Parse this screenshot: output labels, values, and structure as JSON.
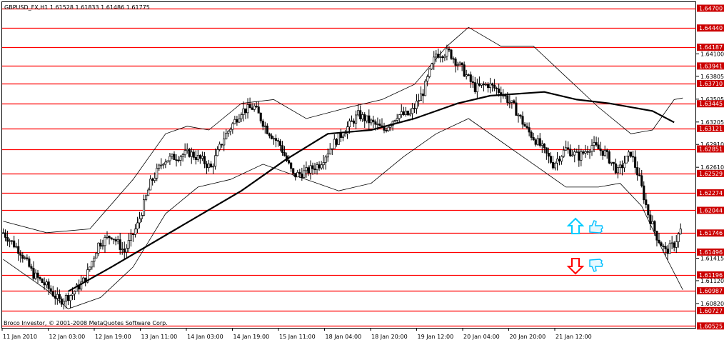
{
  "header": {
    "symbol_line": "GBPUSD_FX,H1  1.61528 1.61833 1.61486 1.61775"
  },
  "credit": "Broco Investor, © 2001-2008 MetaQuotes Software Corp.",
  "colors": {
    "background": "#ffffff",
    "level_line": "#ff0000",
    "level_label_bg": "#cc0000",
    "candle": "#000000",
    "arrow_up": "#00ccff",
    "arrow_down": "#ff0000",
    "hand_icon": "#00bfff"
  },
  "icons": [
    "arrow-up-outline-icon",
    "thumbs-up-hand-icon",
    "arrow-down-outline-icon",
    "thumbs-down-hand-icon"
  ],
  "chart_data": {
    "type": "candlestick",
    "title": "GBPUSD_FX,H1",
    "ylim": [
      1.605,
      1.6478
    ],
    "grid": false,
    "last_price": 1.61775,
    "price_ticks": [
      "1.64100",
      "1.63805",
      "1.63505",
      "1.63205",
      "1.62910",
      "1.62610",
      "1.61415",
      "1.61120",
      "1.60820"
    ],
    "level_labels": [
      "1.64700",
      "1.64440",
      "1.64187",
      "1.63941",
      "1.63710",
      "1.63445",
      "1.63121",
      "1.62851",
      "1.62529",
      "1.62274",
      "1.62044",
      "1.61746",
      "1.61496",
      "1.61196",
      "1.60987",
      "1.60727",
      "1.60525"
    ],
    "levels": [
      1.647,
      1.6444,
      1.64187,
      1.63941,
      1.6371,
      1.63445,
      1.63121,
      1.62851,
      1.62529,
      1.62274,
      1.62044,
      1.61746,
      1.61496,
      1.61196,
      1.60987,
      1.60727,
      1.60525
    ],
    "time_labels": [
      "11 Jan 2010",
      "12 Jan 03:00",
      "12 Jan 19:00",
      "13 Jan 11:00",
      "14 Jan 03:00",
      "14 Jan 19:00",
      "15 Jan 11:00",
      "18 Jan 04:00",
      "18 Jan 20:00",
      "19 Jan 12:00",
      "20 Jan 04:00",
      "20 Jan 20:00",
      "21 Jan 12:00"
    ],
    "close_path": [
      [
        0,
        1.6175
      ],
      [
        8,
        1.615
      ],
      [
        14,
        1.612
      ],
      [
        20,
        1.6105
      ],
      [
        26,
        1.6085
      ],
      [
        32,
        1.6095
      ],
      [
        38,
        1.6115
      ],
      [
        44,
        1.616
      ],
      [
        50,
        1.6172
      ],
      [
        56,
        1.615
      ],
      [
        62,
        1.6185
      ],
      [
        68,
        1.624
      ],
      [
        74,
        1.627
      ],
      [
        80,
        1.6275
      ],
      [
        86,
        1.628
      ],
      [
        92,
        1.627
      ],
      [
        96,
        1.626
      ],
      [
        102,
        1.63
      ],
      [
        110,
        1.6335
      ],
      [
        116,
        1.634
      ],
      [
        122,
        1.631
      ],
      [
        128,
        1.629
      ],
      [
        134,
        1.625
      ],
      [
        140,
        1.6255
      ],
      [
        146,
        1.6265
      ],
      [
        152,
        1.629
      ],
      [
        158,
        1.631
      ],
      [
        164,
        1.633
      ],
      [
        170,
        1.632
      ],
      [
        176,
        1.631
      ],
      [
        182,
        1.633
      ],
      [
        188,
        1.633
      ],
      [
        194,
        1.636
      ],
      [
        200,
        1.641
      ],
      [
        206,
        1.6412
      ],
      [
        212,
        1.639
      ],
      [
        218,
        1.6365
      ],
      [
        224,
        1.637
      ],
      [
        230,
        1.636
      ],
      [
        236,
        1.634
      ],
      [
        242,
        1.631
      ],
      [
        248,
        1.629
      ],
      [
        254,
        1.6265
      ],
      [
        260,
        1.6285
      ],
      [
        266,
        1.6275
      ],
      [
        272,
        1.629
      ],
      [
        278,
        1.628
      ],
      [
        284,
        1.6255
      ],
      [
        290,
        1.628
      ],
      [
        294,
        1.6245
      ],
      [
        298,
        1.62
      ],
      [
        302,
        1.617
      ],
      [
        306,
        1.615
      ],
      [
        310,
        1.616
      ],
      [
        313,
        1.6178
      ]
    ],
    "ma_path": [
      [
        30,
        1.6098
      ],
      [
        50,
        1.613
      ],
      [
        80,
        1.618
      ],
      [
        110,
        1.623
      ],
      [
        130,
        1.627
      ],
      [
        150,
        1.6305
      ],
      [
        170,
        1.631
      ],
      [
        190,
        1.6325
      ],
      [
        210,
        1.6345
      ],
      [
        225,
        1.6355
      ],
      [
        250,
        1.636
      ],
      [
        265,
        1.635
      ],
      [
        280,
        1.6345
      ],
      [
        300,
        1.6335
      ],
      [
        310,
        1.632
      ]
    ],
    "upper_band_path": [
      [
        0,
        1.619
      ],
      [
        20,
        1.6175
      ],
      [
        40,
        1.618
      ],
      [
        60,
        1.6245
      ],
      [
        75,
        1.6305
      ],
      [
        85,
        1.6315
      ],
      [
        95,
        1.631
      ],
      [
        110,
        1.6345
      ],
      [
        125,
        1.635
      ],
      [
        140,
        1.6325
      ],
      [
        160,
        1.634
      ],
      [
        175,
        1.635
      ],
      [
        190,
        1.637
      ],
      [
        205,
        1.642
      ],
      [
        215,
        1.6445
      ],
      [
        230,
        1.642
      ],
      [
        245,
        1.642
      ],
      [
        260,
        1.638
      ],
      [
        275,
        1.634
      ],
      [
        290,
        1.6305
      ],
      [
        300,
        1.631
      ],
      [
        310,
        1.635
      ],
      [
        314,
        1.6352
      ]
    ],
    "lower_band_path": [
      [
        0,
        1.614
      ],
      [
        20,
        1.61
      ],
      [
        30,
        1.6075
      ],
      [
        45,
        1.609
      ],
      [
        60,
        1.613
      ],
      [
        75,
        1.62
      ],
      [
        90,
        1.6235
      ],
      [
        105,
        1.6245
      ],
      [
        120,
        1.6265
      ],
      [
        140,
        1.6245
      ],
      [
        155,
        1.623
      ],
      [
        170,
        1.624
      ],
      [
        185,
        1.6275
      ],
      [
        200,
        1.6305
      ],
      [
        215,
        1.6325
      ],
      [
        230,
        1.6295
      ],
      [
        245,
        1.6265
      ],
      [
        260,
        1.6235
      ],
      [
        275,
        1.6235
      ],
      [
        285,
        1.624
      ],
      [
        295,
        1.621
      ],
      [
        305,
        1.615
      ],
      [
        314,
        1.61
      ]
    ]
  }
}
